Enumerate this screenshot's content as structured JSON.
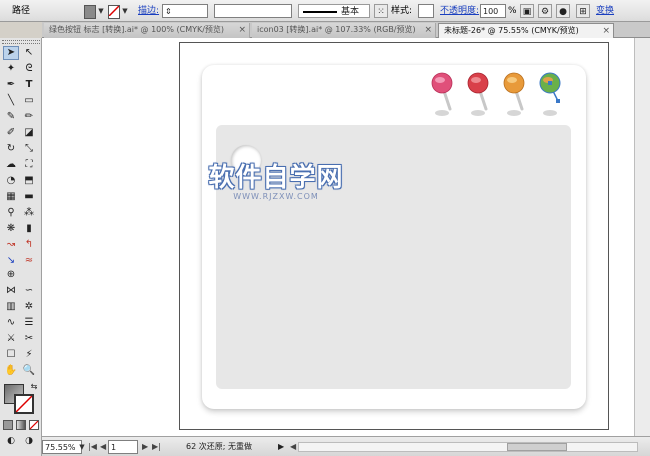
{
  "control_bar": {
    "path_label": "路径",
    "stroke_label": "描边:",
    "stroke_style_label": "基本",
    "style_label": "样式:",
    "opacity_label": "不透明度:",
    "opacity_value": "100",
    "percent": "%",
    "transform_label": "变换"
  },
  "tabs": [
    {
      "label": "绿色按钮 标志 [转换].ai* @ 100% (CMYK/预览)"
    },
    {
      "label": "icon03 [转换].ai* @ 107.33% (RGB/预览)"
    },
    {
      "label": "未标题-26* @ 75.55% (CMYK/预览)"
    }
  ],
  "watermark": {
    "main": "软件自学网",
    "sub": "WWW.RJZXW.COM"
  },
  "status_bar": {
    "zoom_value": "75.55%",
    "page_value": "1",
    "status_text": "62 次还原; 无重做"
  },
  "colors": {
    "pin_pink": "#e0507a",
    "pin_red": "#d9404a",
    "pin_orange": "#e89a3a",
    "pin_green": "#6ab04a",
    "pin_stem_blue": "#3a78c8"
  },
  "icons": {
    "stroke_none": "red-slash",
    "selection": "arrow",
    "type": "T"
  }
}
